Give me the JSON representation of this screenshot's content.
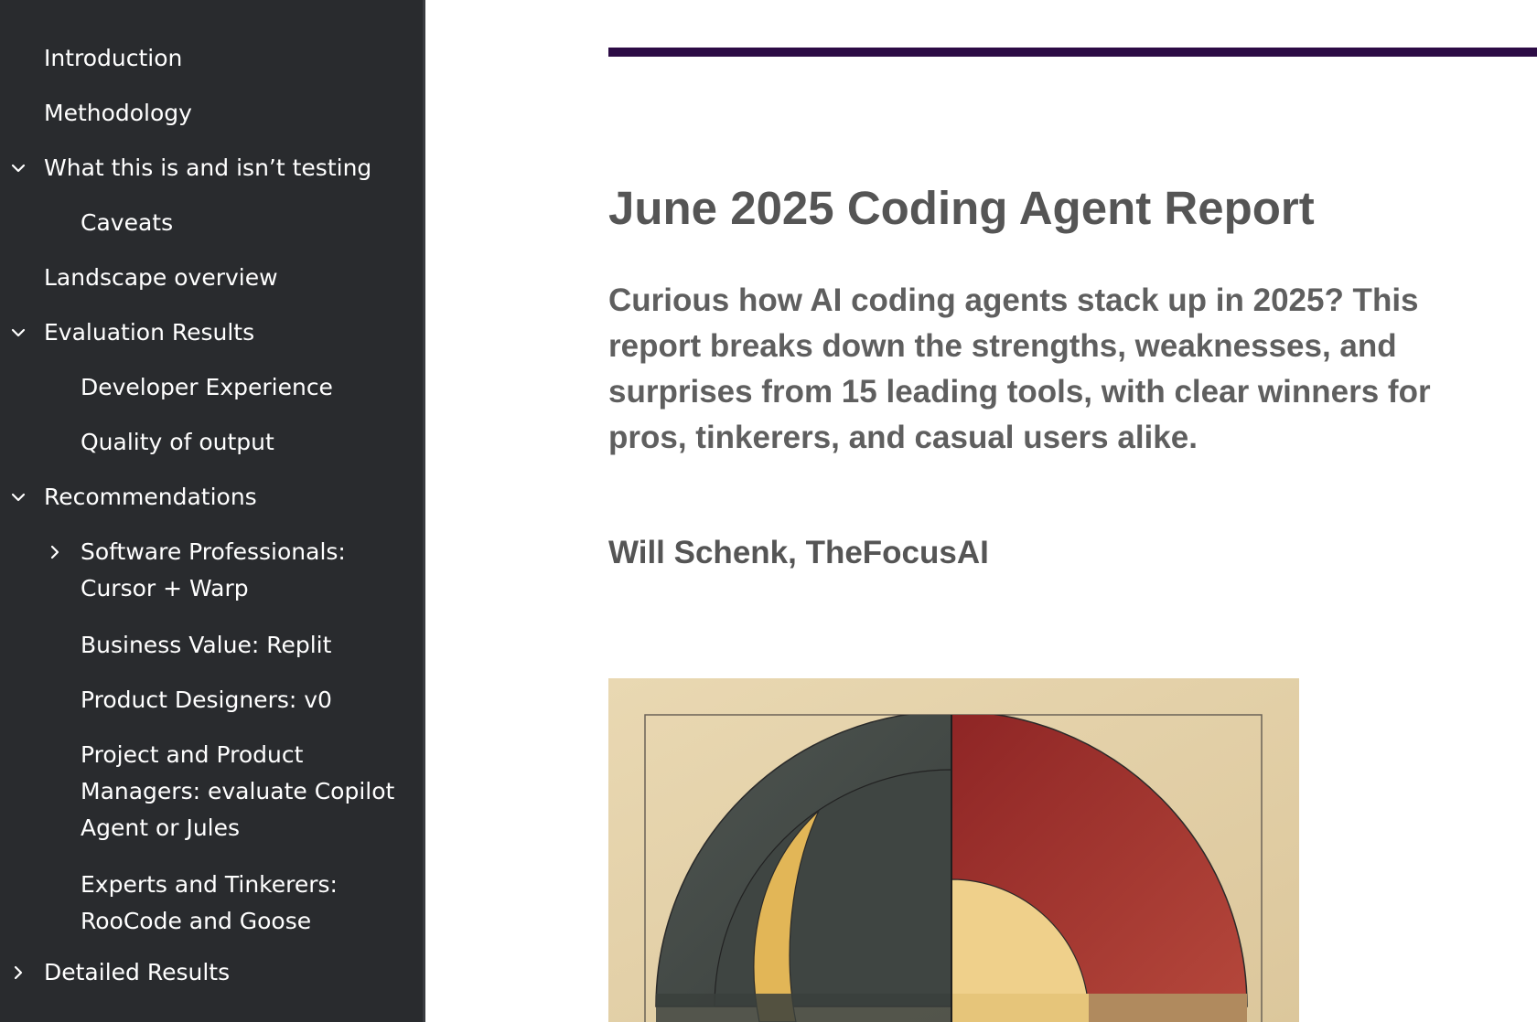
{
  "sidebar": {
    "items": [
      {
        "label": "Introduction",
        "level": 1,
        "chevron": "none"
      },
      {
        "label": "Methodology",
        "level": 1,
        "chevron": "none"
      },
      {
        "label": "What this is and isn’t testing",
        "level": 1,
        "chevron": "down"
      },
      {
        "label": "Caveats",
        "level": 2,
        "chevron": "none"
      },
      {
        "label": "Landscape overview",
        "level": 1,
        "chevron": "none"
      },
      {
        "label": "Evaluation Results",
        "level": 1,
        "chevron": "down"
      },
      {
        "label": "Developer Experience",
        "level": 2,
        "chevron": "none"
      },
      {
        "label": "Quality of output",
        "level": 2,
        "chevron": "none"
      },
      {
        "label": "Recommendations",
        "level": 1,
        "chevron": "down"
      },
      {
        "label": "Software Professionals: Cursor + Warp",
        "level": 2,
        "chevron": "right"
      },
      {
        "label": "Business Value: Replit",
        "level": 2,
        "chevron": "none"
      },
      {
        "label": "Product Designers: v0",
        "level": 2,
        "chevron": "none"
      },
      {
        "label": "Project and Product Managers: evaluate Copilot Agent or Jules",
        "level": 2,
        "chevron": "none"
      },
      {
        "label": "Experts and Tinkerers: RooCode and Goose",
        "level": 2,
        "chevron": "none"
      },
      {
        "label": "Detailed Results",
        "level": 1,
        "chevron": "right"
      }
    ]
  },
  "main": {
    "title": "June 2025 Coding Agent Report",
    "lede": "Curious how AI coding agents stack up in 2025? This report breaks down the strengths, weaknesses, and surprises from 15 leading tools, with clear winners for pros, tinkerers, and casual users alike.",
    "author": "Will Schenk, TheFocusAI"
  },
  "colors": {
    "sidebar_bg": "#292b2e",
    "sidebar_text": "#ffffff",
    "accent_rule": "#2c0b45",
    "heading_text": "#555555"
  },
  "icons": {
    "expanded": "chevron-down-icon",
    "collapsed": "chevron-right-icon"
  }
}
